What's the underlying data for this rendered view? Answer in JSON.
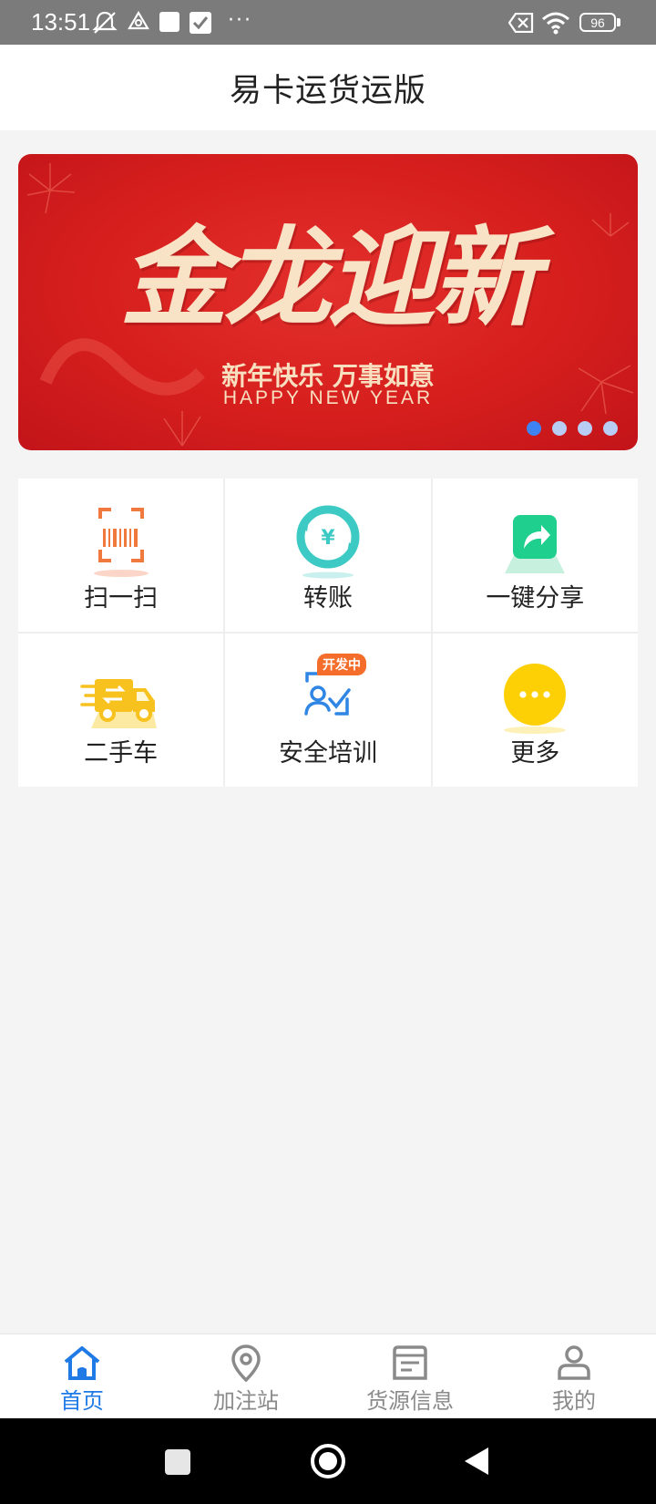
{
  "status_bar": {
    "time": "13:51",
    "battery": "96",
    "more": "···"
  },
  "header": {
    "title": "易卡运货运版"
  },
  "banner": {
    "headline": "金龙迎新",
    "subtitle": "新年快乐 万事如意",
    "english": "HAPPY NEW YEAR",
    "slides": 4,
    "active_slide": 1
  },
  "menu": {
    "items": [
      {
        "label": "扫一扫",
        "icon": "scan-icon"
      },
      {
        "label": "转账",
        "icon": "transfer-icon"
      },
      {
        "label": "一键分享",
        "icon": "share-icon"
      },
      {
        "label": "二手车",
        "icon": "used-truck-icon"
      },
      {
        "label": "安全培训",
        "icon": "safety-training-icon",
        "badge": "开发中"
      },
      {
        "label": "更多",
        "icon": "more-icon"
      }
    ]
  },
  "bottom_nav": {
    "items": [
      {
        "label": "首页",
        "icon": "home-icon",
        "active": true
      },
      {
        "label": "加注站",
        "icon": "location-pin-icon"
      },
      {
        "label": "货源信息",
        "icon": "document-icon"
      },
      {
        "label": "我的",
        "icon": "user-icon"
      }
    ]
  },
  "colors": {
    "accent": "#1f7ae6",
    "banner_red": "#d61f1d",
    "inactive": "#8a8a8a"
  }
}
